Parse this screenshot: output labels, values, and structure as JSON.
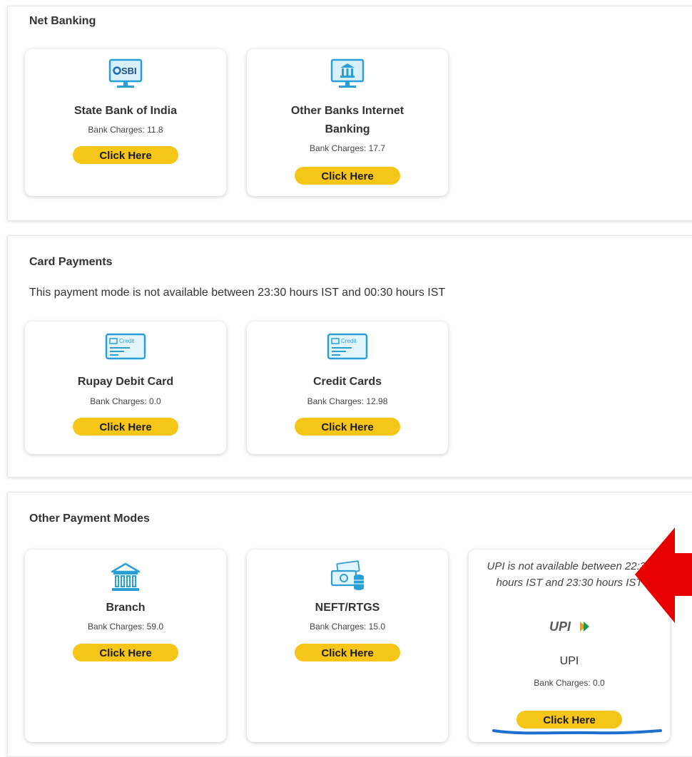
{
  "net_banking": {
    "title": "Net Banking",
    "cards": [
      {
        "icon": "sbi-monitor-icon",
        "name": "State Bank of India",
        "charges": "Bank Charges: 11.8",
        "button": "Click Here",
        "logo_text": "SBI"
      },
      {
        "icon": "bank-monitor-icon",
        "name": "Other Banks Internet Banking",
        "charges": "Bank Charges: 17.7",
        "button": "Click Here"
      }
    ]
  },
  "card_payments": {
    "title": "Card Payments",
    "note": "This payment mode is not available between 23:30 hours IST and 00:30 hours IST",
    "cards": [
      {
        "icon": "credit-card-icon",
        "name": "Rupay Debit Card",
        "charges": "Bank Charges: 0.0",
        "button": "Click Here",
        "card_text": "Credit"
      },
      {
        "icon": "credit-card-icon",
        "name": "Credit Cards",
        "charges": "Bank Charges: 12.98",
        "button": "Click Here",
        "card_text": "Credit"
      }
    ]
  },
  "other_modes": {
    "title": "Other Payment Modes",
    "cards": [
      {
        "icon": "bank-building-icon",
        "name": "Branch",
        "charges": "Bank Charges: 59.0",
        "button": "Click Here"
      },
      {
        "icon": "cash-coins-icon",
        "name": "NEFT/RTGS",
        "charges": "Bank Charges: 15.0",
        "button": "Click Here"
      },
      {
        "icon": "upi-logo-icon",
        "note": "UPI is not available between 22:30 hours IST and 23:30 hours IST",
        "name": "UPI",
        "charges": "Bank Charges: 0.0",
        "button": "Click Here",
        "logo_text": "UPI"
      }
    ]
  },
  "colors": {
    "button": "#f5c518",
    "icon_teal": "#2a9fd6",
    "arrow": "#e60000",
    "underline": "#1f6fd0"
  }
}
